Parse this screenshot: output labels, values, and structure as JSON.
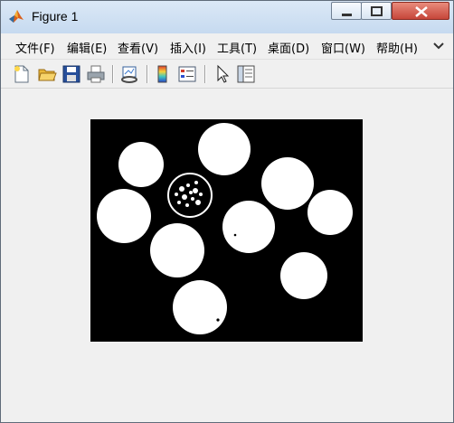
{
  "window": {
    "title": "Figure 1",
    "app_icon": "matlab-icon",
    "controls": [
      "minimize-icon",
      "maximize-icon",
      "close-icon"
    ]
  },
  "menu": {
    "items": [
      {
        "label": "文件(F)"
      },
      {
        "label": "编辑(E)"
      },
      {
        "label": "查看(V)"
      },
      {
        "label": "插入(I)"
      },
      {
        "label": "工具(T)"
      },
      {
        "label": "桌面(D)"
      },
      {
        "label": "窗口(W)"
      },
      {
        "label": "帮助(H)"
      }
    ],
    "overflow_icon": "menu-arrow-icon"
  },
  "toolbar": {
    "buttons": [
      "new-figure-icon",
      "open-file-icon",
      "save-icon",
      "print-icon",
      "link-plot-icon",
      "colorbar-icon",
      "legend-icon",
      "pointer-icon",
      "property-editor-icon"
    ]
  },
  "figure": {
    "background": "#000000",
    "foreground": "#ffffff"
  }
}
